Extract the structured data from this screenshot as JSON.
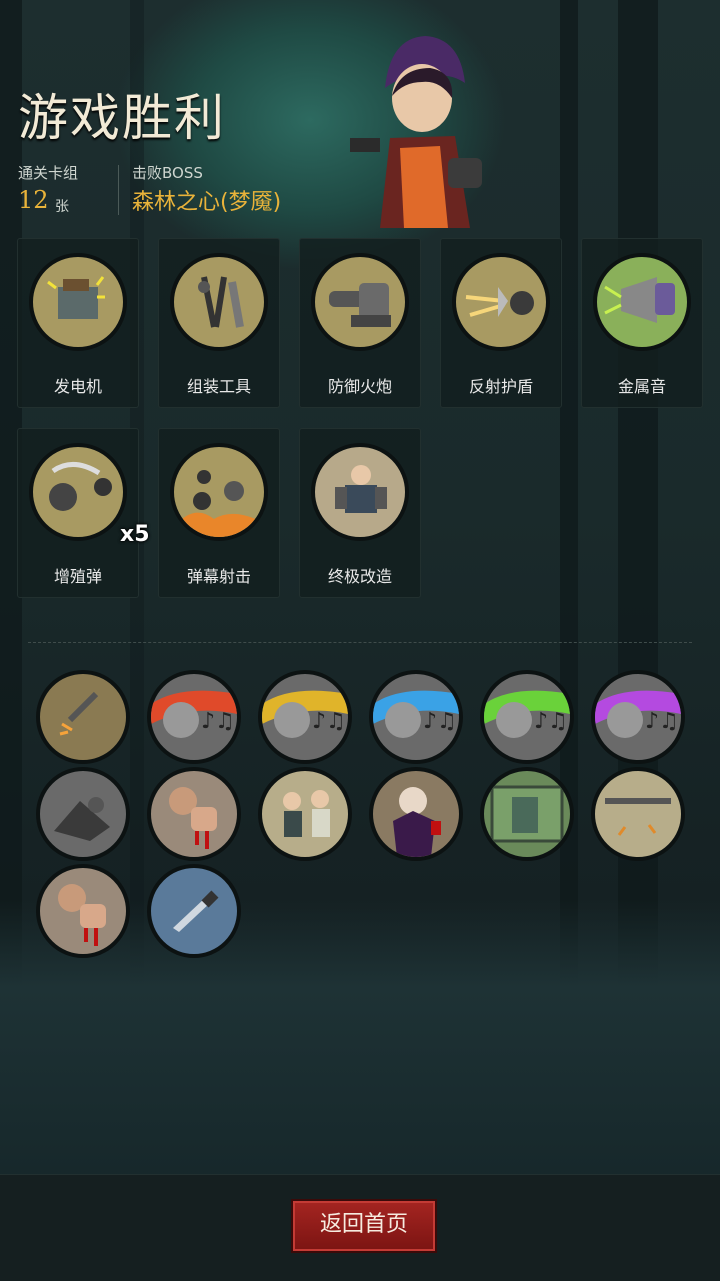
{
  "header": {
    "title": "游戏胜利",
    "deck_label": "通关卡组",
    "deck_count": "12",
    "deck_unit": "张",
    "boss_label": "击败BOSS",
    "boss_name": "森林之心(梦魇)"
  },
  "cards": [
    {
      "label": "发电机",
      "icon": "generator-icon"
    },
    {
      "label": "组装工具",
      "icon": "tools-icon"
    },
    {
      "label": "防御火炮",
      "icon": "cannon-icon"
    },
    {
      "label": "反射护盾",
      "icon": "shield-icon"
    },
    {
      "label": "金属音",
      "icon": "loudspeaker-icon"
    },
    {
      "label": "增殖弹",
      "icon": "bomb-icon",
      "badge": "x5"
    },
    {
      "label": "弹幕射击",
      "icon": "barrage-icon"
    },
    {
      "label": "终极改造",
      "icon": "mech-icon"
    }
  ],
  "relics": [
    {
      "icon": "spark-drill-icon"
    },
    {
      "icon": "music-skull-red-icon",
      "color": "#e04a2a"
    },
    {
      "icon": "music-skull-yellow-icon",
      "color": "#e0b42a"
    },
    {
      "icon": "music-skull-blue-icon",
      "color": "#3aa2e6"
    },
    {
      "icon": "music-skull-green-icon",
      "color": "#6ad23a"
    },
    {
      "icon": "music-skull-purple-icon",
      "color": "#b44ae0"
    },
    {
      "icon": "scrap-icon"
    },
    {
      "icon": "bleeding-fist-icon"
    },
    {
      "icon": "duo-icon"
    },
    {
      "icon": "vampire-icon"
    },
    {
      "icon": "robot-screen-icon"
    },
    {
      "icon": "bone-crack-icon"
    },
    {
      "icon": "bleeding-fist-icon"
    },
    {
      "icon": "knife-icon"
    }
  ],
  "footer": {
    "back_label": "返回首页"
  },
  "colors": {
    "accent": "#e9b33a",
    "button": "#a52521",
    "panel": "#121e1e"
  }
}
